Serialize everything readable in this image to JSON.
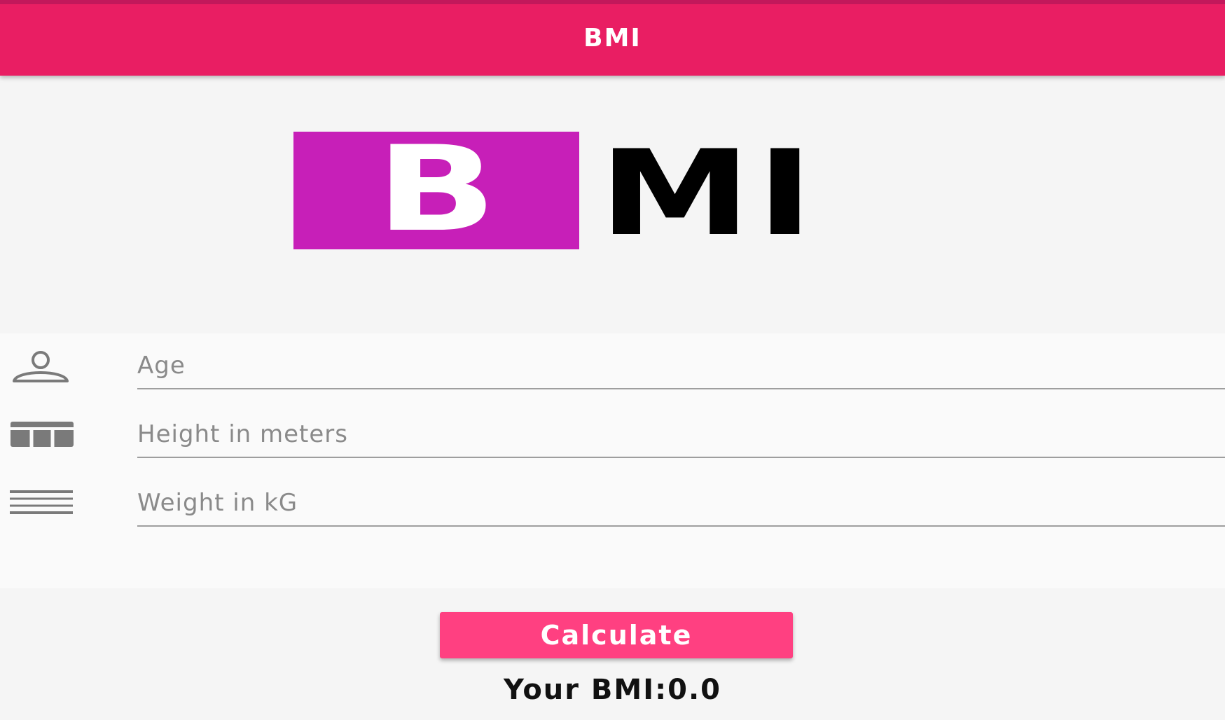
{
  "appbar": {
    "title": "BMI"
  },
  "logo": {
    "box_letter": "B",
    "rest_text": "MI",
    "box_color": "#c71fb8"
  },
  "form": {
    "fields": [
      {
        "icon": "person-icon",
        "placeholder": "Age",
        "value": ""
      },
      {
        "icon": "ruler-icon",
        "placeholder": "Height in meters",
        "value": ""
      },
      {
        "icon": "lines-icon",
        "placeholder": "Weight in kG",
        "value": ""
      }
    ]
  },
  "actions": {
    "calculate_label": "Calculate"
  },
  "result": {
    "text": "Your BMI:0.0"
  },
  "colors": {
    "primary": "#e91e63",
    "accent": "#ff4081",
    "background": "#f5f5f5"
  }
}
